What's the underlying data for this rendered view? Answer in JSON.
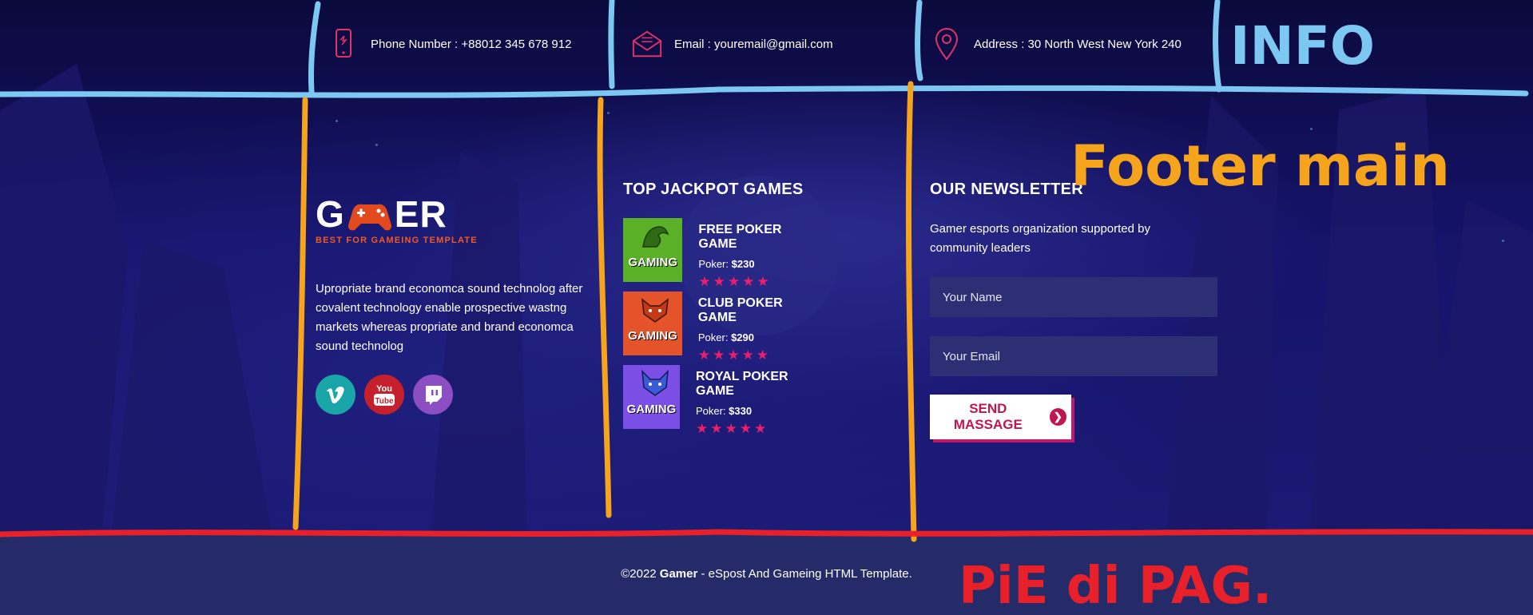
{
  "info_bar": {
    "phone": "Phone Number : +88012 345 678 912",
    "email": "Email : youremail@gmail.com",
    "address": "Address : 30 North West New York 240"
  },
  "brand": {
    "logo_text_left": "G",
    "logo_text_a": "A",
    "logo_text_right": "ER",
    "tagline": "BEST FOR GAMEING TEMPLATE",
    "about": "Upropriate brand economca sound technolog after covalent technology enable prospective wastng markets whereas propriate and brand economca sound technolog",
    "socials": [
      {
        "name": "vimeo",
        "glyph": "v",
        "color": "#1aa5a8"
      },
      {
        "name": "youtube",
        "glyph": "You",
        "color": "#c5202b"
      },
      {
        "name": "twitch",
        "glyph": "t",
        "color": "#8b4fc3"
      }
    ]
  },
  "games": {
    "title": "TOP JACKPOT GAMES",
    "items": [
      {
        "name": "FREE POKER GAME",
        "price_label": "Poker:",
        "price": "$230",
        "thumb_color": "#5ab026",
        "thumb_text": "GAMING"
      },
      {
        "name": "CLUB POKER GAME",
        "price_label": "Poker:",
        "price": "$290",
        "thumb_color": "#e5532a",
        "thumb_text": "GAMING"
      },
      {
        "name": "ROYAL POKER GAME",
        "price_label": "Poker:",
        "price": "$330",
        "thumb_color": "#7b4fe6",
        "thumb_text": "GAMING"
      }
    ],
    "rating_stars": 5
  },
  "newsletter": {
    "title": "OUR NEWSLETTER",
    "description": "Gamer esports organization supported by community leaders",
    "name_placeholder": "Your Name",
    "email_placeholder": "Your Email",
    "button_label": "SEND MASSAGE"
  },
  "bottom": {
    "copyright_prefix": "©2022",
    "copyright_brand": "Gamer",
    "copyright_suffix": "- eSpost And Gameing HTML Template."
  },
  "annotations": {
    "info": "INFO",
    "footer_main": "Footer main",
    "pie_di_pag": "PiE di PAG.",
    "colors": {
      "blue": "#7cc8f2",
      "orange": "#f5a41c",
      "red": "#e8202a"
    }
  }
}
